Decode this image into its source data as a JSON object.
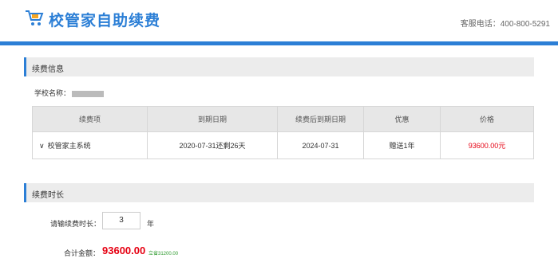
{
  "header": {
    "brand": "校管家自助续费",
    "service": "客服电话：400-800-5291",
    "accent": "#2c7fd6"
  },
  "info": {
    "title": "续费信息",
    "school_label": "学校名称："
  },
  "table": {
    "headers": [
      "续费项",
      "到期日期",
      "续费后到期日期",
      "优惠",
      "价格"
    ],
    "row": {
      "item": "校管家主系统",
      "expire": "2020-07-31还剩26天",
      "new_expire": "2024-07-31",
      "discount": "赠送1年",
      "price": "93600.00元"
    }
  },
  "duration": {
    "title": "续费时长",
    "label": "请输续费时长：",
    "value": "3",
    "unit": "年"
  },
  "total": {
    "label": "合计金额：",
    "amount": "93600.00",
    "saved": "立省31200.00"
  }
}
